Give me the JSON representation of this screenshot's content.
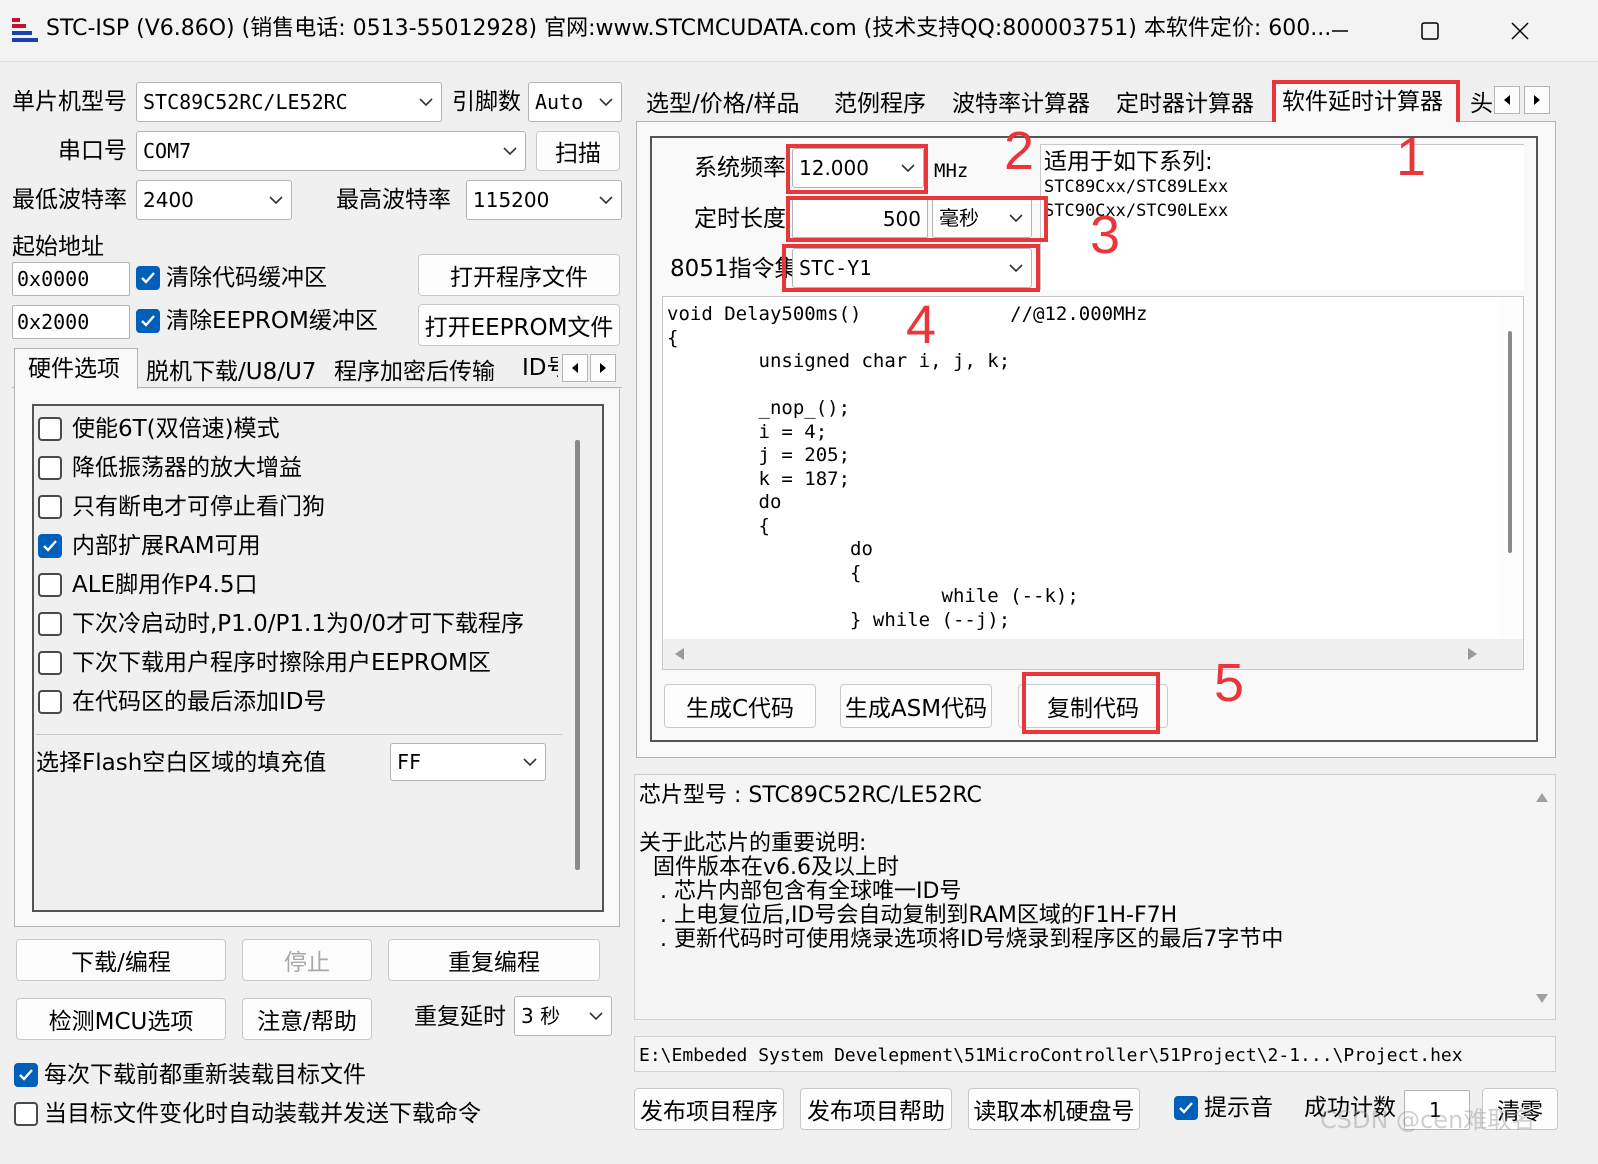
{
  "window": {
    "title": "STC-ISP (V6.86O) (销售电话: 0513-55012928) 官网:www.STCMCUDATA.com  (技术支持QQ:800003751) 本软件定价: 600..."
  },
  "left": {
    "mcu_label": "单片机型号",
    "mcu_value": "STC89C52RC/LE52RC",
    "pins_label": "引脚数",
    "pins_value": "Auto",
    "port_label": "串口号",
    "port_value": "COM7",
    "scan_button": "扫描",
    "min_baud_label": "最低波特率",
    "min_baud_value": "2400",
    "max_baud_label": "最高波特率",
    "max_baud_value": "115200",
    "start_addr_label": "起始地址",
    "addr1": "0x0000",
    "clear_code_label": "清除代码缓冲区",
    "open_program_button": "打开程序文件",
    "addr2": "0x2000",
    "clear_eeprom_label": "清除EEPROM缓冲区",
    "open_eeprom_button": "打开EEPROM文件",
    "tabs": [
      "硬件选项",
      "脱机下载/U8/U7",
      "程序加密后传输",
      "ID号"
    ],
    "options": [
      {
        "label": "使能6T(双倍速)模式",
        "checked": false
      },
      {
        "label": "降低振荡器的放大增益",
        "checked": false
      },
      {
        "label": "只有断电才可停止看门狗",
        "checked": false
      },
      {
        "label": "内部扩展RAM可用",
        "checked": true
      },
      {
        "label": "ALE脚用作P4.5口",
        "checked": false
      },
      {
        "label": "下次冷启动时,P1.0/P1.1为0/0才可下载程序",
        "checked": false
      },
      {
        "label": "下次下载用户程序时擦除用户EEPROM区",
        "checked": false
      },
      {
        "label": "在代码区的最后添加ID号",
        "checked": false
      }
    ],
    "fill_label": "选择Flash空白区域的填充值",
    "fill_value": "FF",
    "download_button": "下载/编程",
    "stop_button": "停止",
    "repeat_button": "重复编程",
    "detect_button": "检测MCU选项",
    "help_button": "注意/帮助",
    "repeat_delay_label": "重复延时",
    "repeat_delay_value": "3 秒",
    "reload_label": "每次下载前都重新装载目标文件",
    "autoload_label": "当目标文件变化时自动装载并发送下载命令"
  },
  "right": {
    "tabs": [
      "选型/价格/样品",
      "范例程序",
      "波特率计算器",
      "定时器计算器",
      "软件延时计算器",
      "头"
    ],
    "freq_label": "系统频率",
    "freq_value": "12.000",
    "freq_unit": "MHz",
    "series_title": "适用于如下系列:",
    "series_1": "STC89Cxx/STC89LExx",
    "series_2": "STC90Cxx/STC90LExx",
    "duration_label": "定时长度",
    "duration_value": "500",
    "duration_unit": "毫秒",
    "isa_label": "8051指令集",
    "isa_value": "STC-Y1",
    "code_lines": [
      "void Delay500ms()             //@12.000MHz",
      "{",
      "        unsigned char i, j, k;",
      "",
      "        _nop_();",
      "        i = 4;",
      "        j = 205;",
      "        k = 187;",
      "        do",
      "        {",
      "                do",
      "                {",
      "                        while (--k);",
      "                } while (--j);"
    ],
    "gen_c_button": "生成C代码",
    "gen_asm_button": "生成ASM代码",
    "copy_button": "复制代码",
    "annotations": [
      "1",
      "2",
      "3",
      "4",
      "5"
    ],
    "info_lines": [
      "芯片型号 : STC89C52RC/LE52RC",
      "",
      "关于此芯片的重要说明:",
      "  固件版本在v6.6及以上时",
      "   . 芯片内部包含有全球唯一ID号",
      "   . 上电复位后,ID号会自动复制到RAM区域的F1H-F7H",
      "   . 更新代码时可使用烧录选项将ID号烧录到程序区的最后7字节中"
    ],
    "file_path": "E:\\Embeded System Develepment\\51MicroController\\51Project\\2-1...\\Project.hex",
    "publish_program_button": "发布项目程序",
    "publish_help_button": "发布项目帮助",
    "read_disk_button": "读取本机硬盘号",
    "beep_label": "提示音",
    "success_count_label": "成功计数",
    "success_count_value": "1",
    "clear_button": "清零",
    "watermark": "CSDN @cen难取名"
  },
  "colors": {
    "accent": "#005fb8",
    "annotation": "#e8363b"
  }
}
